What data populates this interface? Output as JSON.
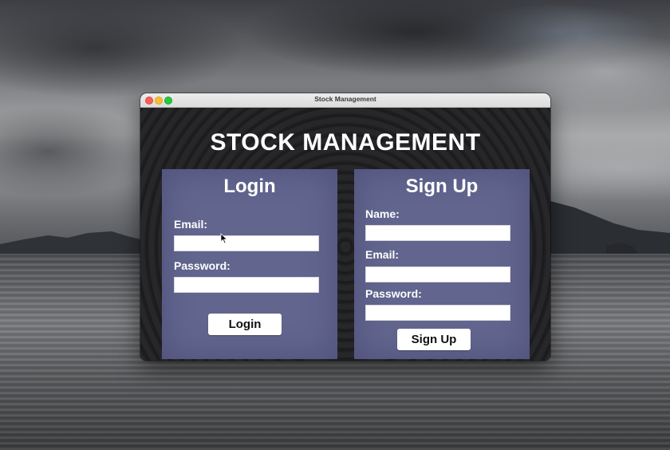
{
  "window": {
    "title": "Stock Management"
  },
  "app": {
    "title": "STOCK MANAGEMENT"
  },
  "login": {
    "heading": "Login",
    "email_label": "Email:",
    "email_value": "",
    "password_label": "Password:",
    "password_value": "",
    "button_label": "Login"
  },
  "signup": {
    "heading": "Sign Up",
    "name_label": "Name:",
    "name_value": "",
    "email_label": "Email:",
    "email_value": "",
    "password_label": "Password:",
    "password_value": "",
    "button_label": "Sign Up"
  },
  "colors": {
    "panel": "#62658e",
    "background": "#1f1f21",
    "traffic_close": "#ff5f57",
    "traffic_minimize": "#febc2e",
    "traffic_maximize": "#28c840"
  }
}
